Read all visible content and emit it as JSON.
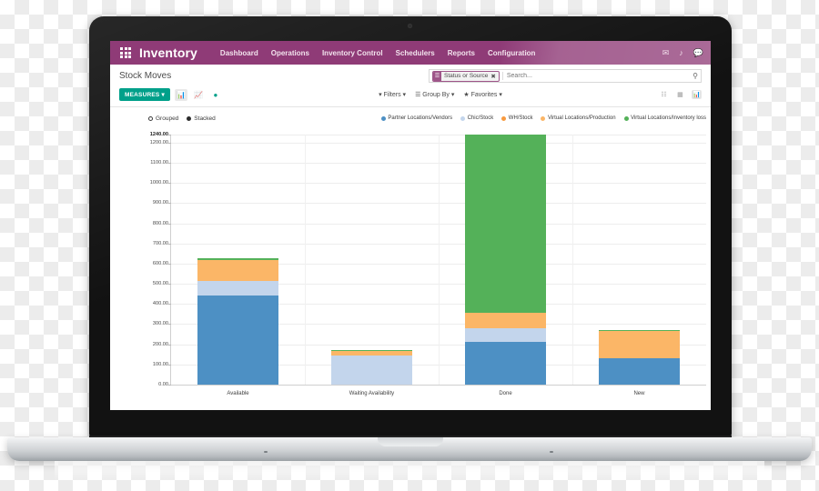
{
  "navbar": {
    "apps_icon": "apps-grid-icon",
    "brand": "Inventory",
    "menu": [
      "Dashboard",
      "Operations",
      "Inventory Control",
      "Schedulers",
      "Reports",
      "Configuration"
    ],
    "right_icons": [
      "mail-icon",
      "activity-icon",
      "messages-icon"
    ]
  },
  "control_panel": {
    "breadcrumb": "Stock Moves",
    "search": {
      "facet_label": "Status or Source",
      "facet_remove": "✖",
      "placeholder": "Search...",
      "value": ""
    },
    "measures_label": "MEASURES",
    "chart_type_icons": [
      "bar-chart-icon",
      "line-chart-icon",
      "pie-chart-icon"
    ],
    "filters": [
      {
        "label": "Filters",
        "icon": "funnel-icon"
      },
      {
        "label": "Group By",
        "icon": "list-icon"
      },
      {
        "label": "Favorites",
        "icon": "star-icon"
      }
    ],
    "view_switcher": [
      "list-view-icon",
      "pivot-view-icon",
      "graph-view-icon"
    ],
    "active_view": "graph-view-icon"
  },
  "mode_legend": [
    {
      "label": "Grouped",
      "selected": false
    },
    {
      "label": "Stacked",
      "selected": true
    }
  ],
  "colors": {
    "brand_purple": "#8f3b77",
    "measures_green": "#00a08a",
    "partner_blue": "#4d90c4",
    "chic_lightblue": "#c3d5ec",
    "wh_orange": "#f89a3f",
    "virtual_prod_orange": "#fbb667",
    "inventory_loss_green": "#54b159"
  },
  "chart_data": {
    "type": "bar",
    "stacked": true,
    "title": "Stock Moves",
    "xlabel": "",
    "ylabel": "",
    "ylim": [
      0,
      1240
    ],
    "ytick_values": [
      0,
      100,
      200,
      300,
      400,
      500,
      600,
      700,
      800,
      900,
      1000,
      1100,
      1200,
      1240
    ],
    "ytick_labels": [
      "0.00",
      "100.00",
      "200.00",
      "300.00",
      "400.00",
      "500.00",
      "600.00",
      "700.00",
      "800.00",
      "900.00",
      "1000.00",
      "1100.00",
      "1200.00",
      "1240.00"
    ],
    "max_tick_label": "1240.00",
    "grid": true,
    "legend_position": "top-right",
    "categories": [
      "Available",
      "Waiting Availability",
      "Done",
      "New"
    ],
    "series": [
      {
        "name": "Partner Locations/Vendors",
        "color": "#4d90c4",
        "values": [
          440,
          0,
          210,
          130
        ]
      },
      {
        "name": "Chic/Stock",
        "color": "#c3d5ec",
        "values": [
          72,
          145,
          70,
          0
        ]
      },
      {
        "name": "WH/Stock",
        "color": "#f89a3f",
        "values": [
          0,
          0,
          0,
          0
        ]
      },
      {
        "name": "Virtual Locations/Production",
        "color": "#fbb667",
        "values": [
          108,
          20,
          75,
          135
        ]
      },
      {
        "name": "Virtual Locations/Inventory loss",
        "color": "#54b159",
        "values": [
          6,
          5,
          885,
          5
        ]
      }
    ],
    "totals": [
      626,
      170,
      1240,
      270
    ]
  }
}
